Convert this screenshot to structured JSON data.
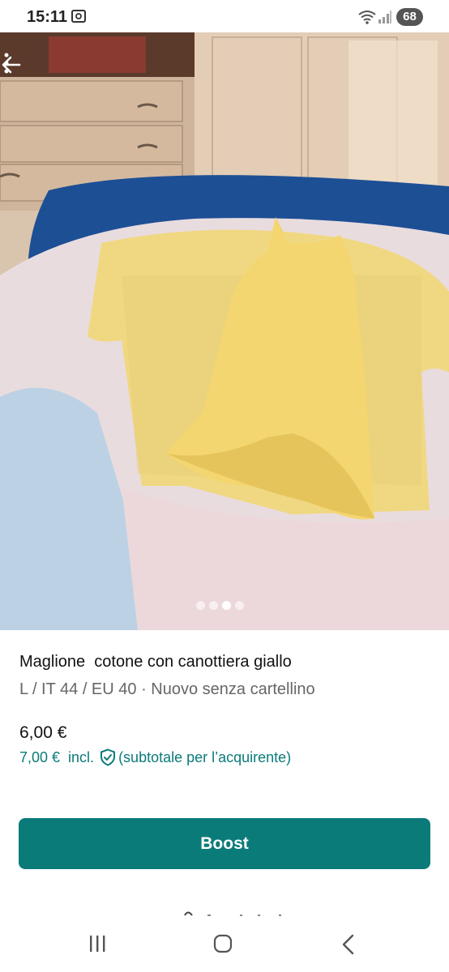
{
  "status_bar": {
    "time": "15:11",
    "battery": "68"
  },
  "photo": {
    "total_images": 4,
    "active_index": 2
  },
  "item": {
    "title": "Maglione  cotone con canottiera giallo",
    "details": "L / IT 44 / EU 40 · Nuovo senza cartellino",
    "price": "6,00 €",
    "buyer_price": "7,00 €  incl.",
    "buyer_note": "(subtotale per l’acquirente)"
  },
  "actions": {
    "boost_label": "Boost"
  },
  "colors": {
    "accent": "#0b7b7a"
  }
}
